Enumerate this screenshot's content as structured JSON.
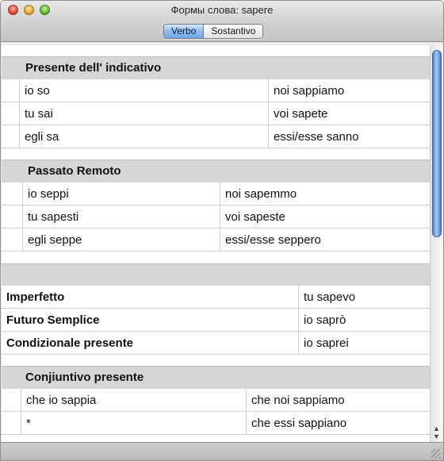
{
  "window": {
    "title": "Формы слова: sapere"
  },
  "toolbar": {
    "tabs": [
      "Verbo",
      "Sostantivo"
    ],
    "active": "Verbo"
  },
  "sections": {
    "presente": {
      "title": "Presente dell' indicativo",
      "rows": [
        [
          "io so",
          "noi sappiamo"
        ],
        [
          "tu sai",
          "voi sapete"
        ],
        [
          "egli sa",
          "essi/esse sanno"
        ]
      ]
    },
    "passato": {
      "title": "Passato Remoto",
      "rows": [
        [
          "io seppi",
          "noi sapemmo"
        ],
        [
          "tu sapesti",
          "voi sapeste"
        ],
        [
          "egli seppe",
          "essi/esse seppero"
        ]
      ]
    },
    "single": {
      "rows": [
        [
          "Imperfetto",
          "tu sapevo"
        ],
        [
          "Futuro Semplice",
          "io saprò"
        ],
        [
          "Condizionale presente",
          "io saprei"
        ]
      ]
    },
    "congiuntivo": {
      "title": "Conjiuntivo presente",
      "rows": [
        [
          "che io sappia",
          "che noi sappiamo"
        ],
        [
          "*",
          "che essi sappiano"
        ]
      ]
    }
  }
}
